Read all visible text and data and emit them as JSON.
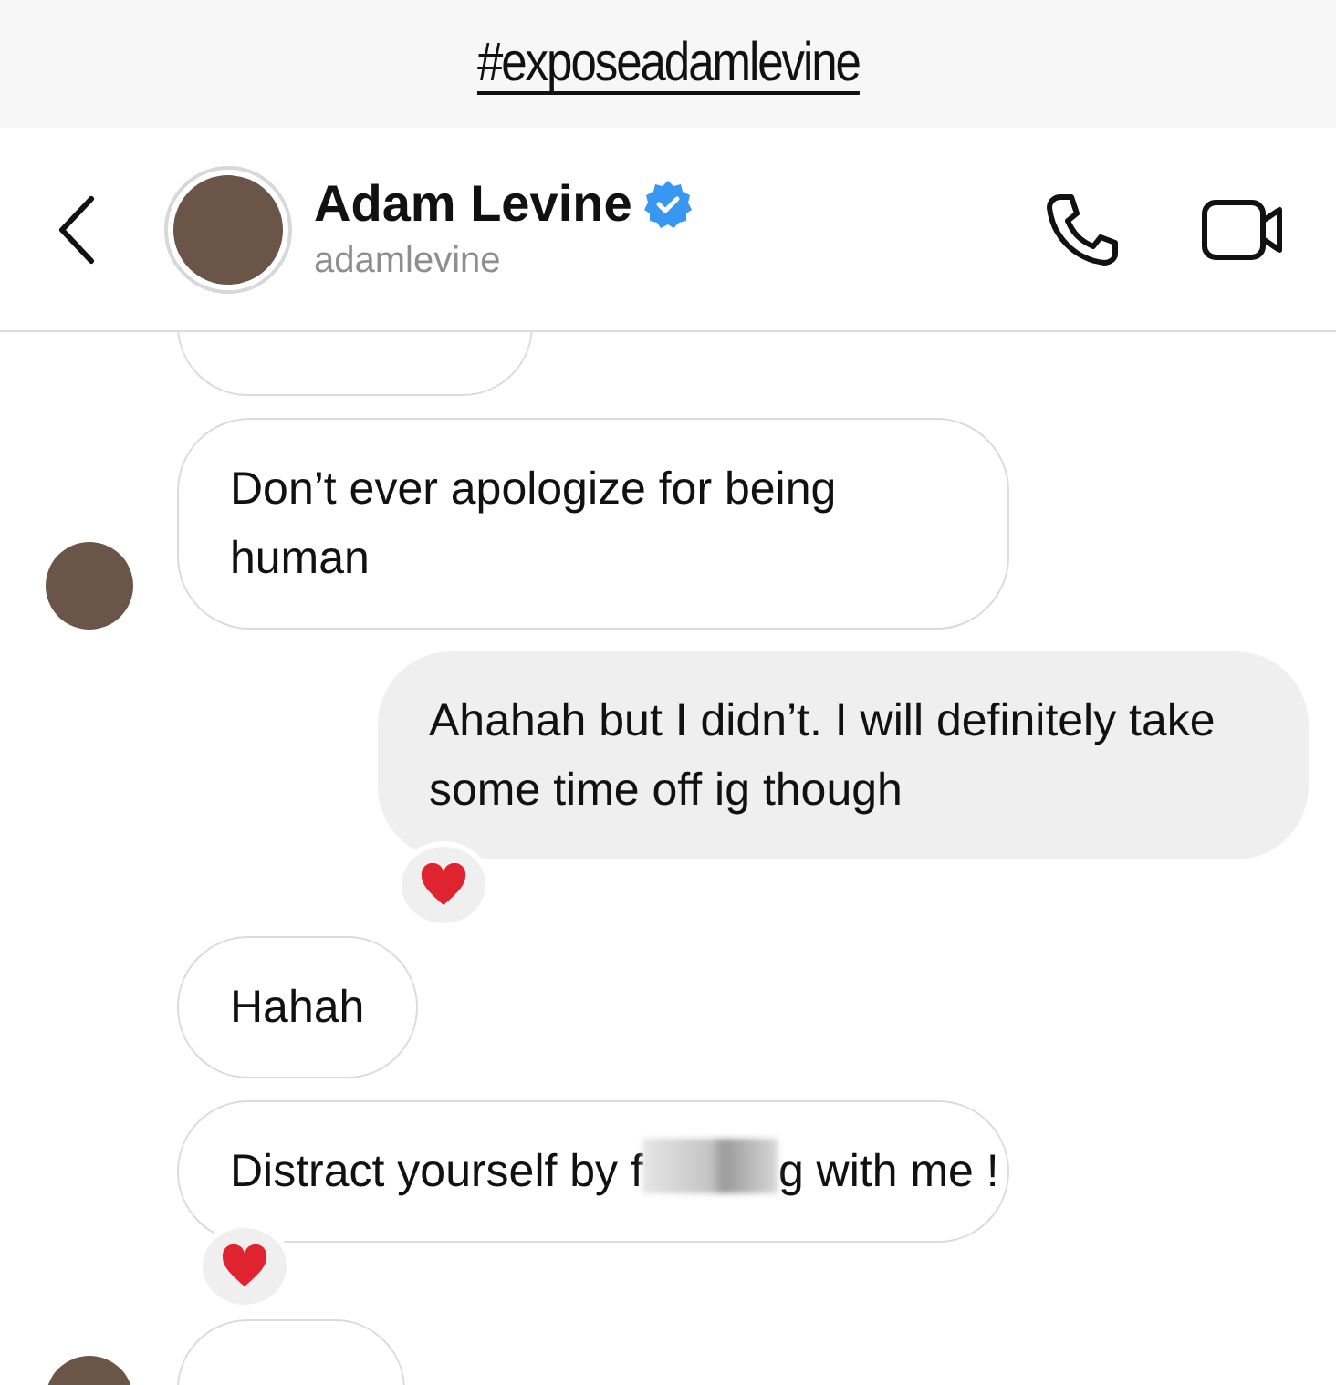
{
  "banner": {
    "hashtag": "#exposeadamlevine"
  },
  "header": {
    "name": "Adam Levine",
    "verified": true,
    "username": "adamlevine"
  },
  "messages": [
    {
      "kind": "partial",
      "avatar": false,
      "reaction": false
    },
    {
      "kind": "incoming",
      "text": "Don’t ever apologize for being human",
      "avatar": true,
      "reaction": false
    },
    {
      "kind": "outgoing",
      "text": "Ahahah but I didn’t. I will definitely take some time off ig though",
      "avatar": false,
      "reaction": true
    },
    {
      "kind": "incoming",
      "text": "Hahah",
      "avatar": false,
      "reaction": false
    },
    {
      "kind": "censored",
      "text_before": "Distract yourself by f",
      "text_after": "g with me !",
      "avatar": false,
      "reaction": true
    },
    {
      "kind": "partial",
      "avatar": true,
      "reaction": false
    }
  ]
}
